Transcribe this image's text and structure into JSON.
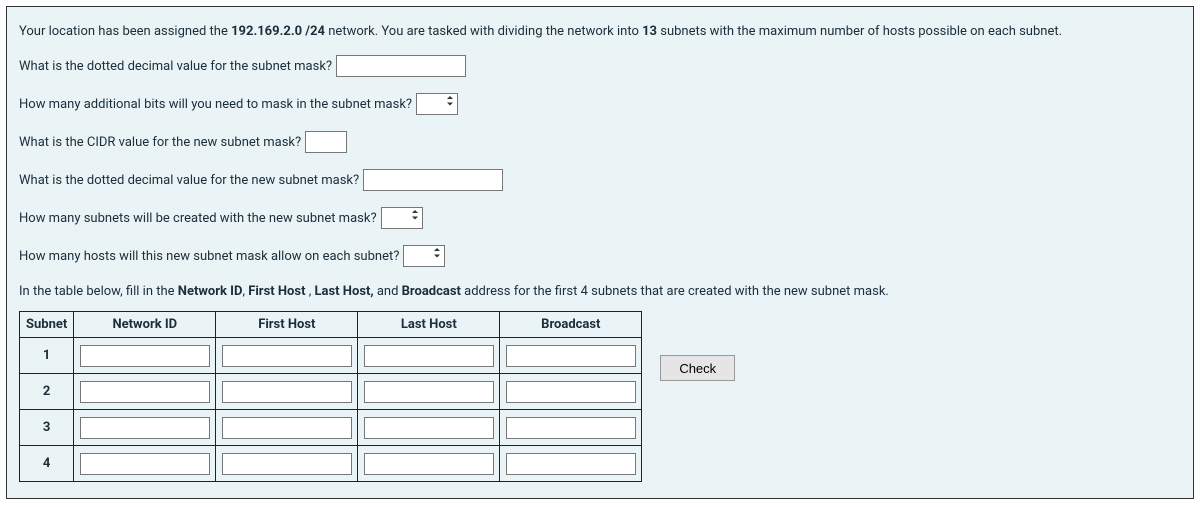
{
  "intro": {
    "p1": "Your location has been assigned the ",
    "bold1": "192.169.2.0 /24",
    "p2": " network.  You are tasked with dividing the network into ",
    "bold2": "13",
    "p3": " subnets with the maximum number of hosts possible on each subnet."
  },
  "questions": {
    "q1": "What is the dotted decimal value for the subnet mask?",
    "q2": "How many additional bits will you need to mask in the subnet mask?",
    "q3": "What is the CIDR value for the new subnet mask?",
    "q4": "What is the dotted decimal value for the new subnet mask?",
    "q5": "How many subnets will be created with the new subnet mask?",
    "q6": "How many hosts will this new subnet mask allow on each subnet?"
  },
  "table": {
    "intro_p1": "In the table below, fill in the ",
    "intro_b1": "Network ID",
    "intro_s1": ", ",
    "intro_b2": "First Host ",
    "intro_s2": ", ",
    "intro_b3": "Last Host,",
    "intro_s3": " and ",
    "intro_b4": "Broadcast",
    "intro_p2": " address for the first 4 subnets that are created with the new subnet mask.",
    "headers": {
      "subnet": "Subnet",
      "network_id": "Network ID",
      "first_host": "First Host",
      "last_host": "Last Host",
      "broadcast": "Broadcast"
    },
    "rows": [
      "1",
      "2",
      "3",
      "4"
    ]
  },
  "buttons": {
    "check": "Check"
  }
}
